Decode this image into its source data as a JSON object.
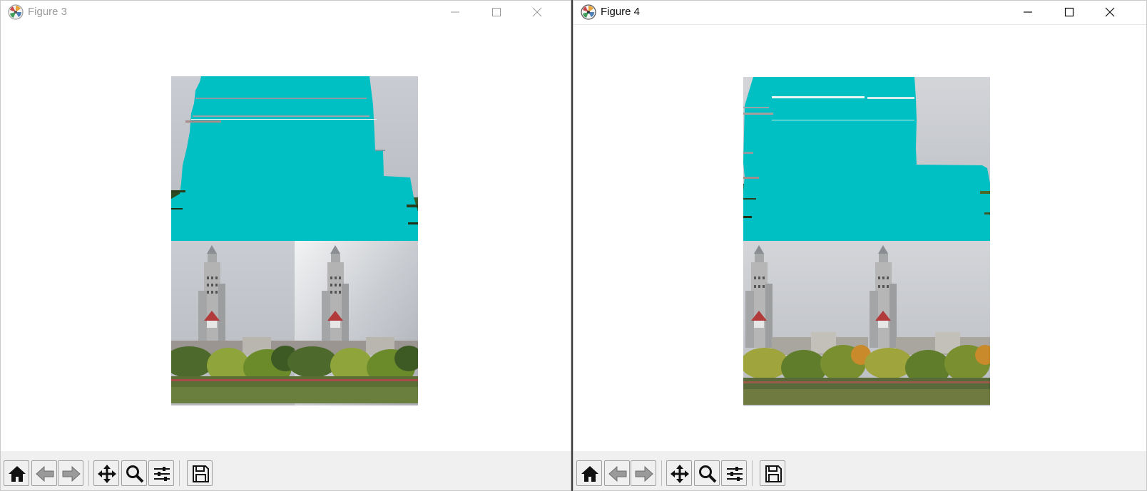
{
  "windows": [
    {
      "title": "Figure 3",
      "active": false,
      "buttons": {
        "minimize": "minimize",
        "maximize": "maximize",
        "close": "close"
      }
    },
    {
      "title": "Figure 4",
      "active": true,
      "buttons": {
        "minimize": "minimize",
        "maximize": "maximize",
        "close": "close"
      }
    }
  ],
  "toolbar_icons": [
    "home-icon",
    "back-arrow-icon",
    "forward-arrow-icon",
    "pan-move-icon",
    "zoom-magnifier-icon",
    "configure-subplots-icon",
    "save-figure-icon"
  ],
  "colors": {
    "mask_cyan": "#00c0c4",
    "toolbar_bg": "#f0f0f0",
    "title_inactive": "#9a9a9a",
    "title_active": "#111111"
  }
}
